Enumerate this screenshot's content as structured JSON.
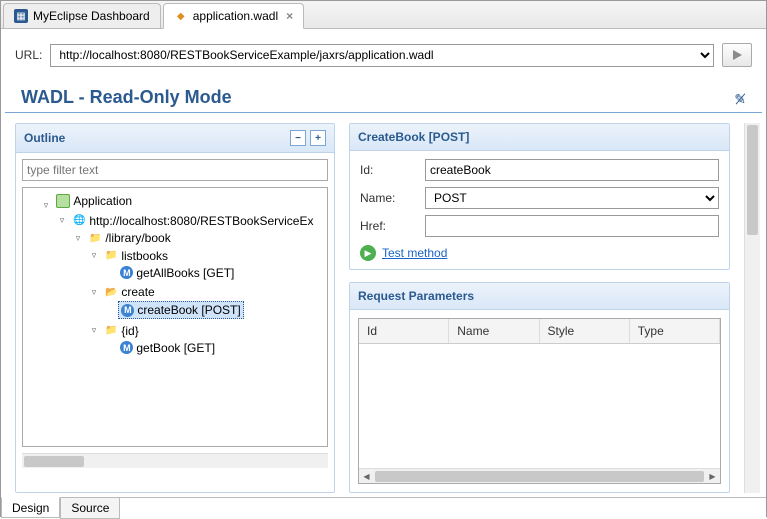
{
  "tabs": {
    "dashboard": "MyEclipse Dashboard",
    "active": "application.wadl"
  },
  "urlbar": {
    "label": "URL:",
    "value": "http://localhost:8080/RESTBookServiceExample/jaxrs/application.wadl"
  },
  "header": {
    "title": "WADL - Read-Only Mode"
  },
  "outline": {
    "title": "Outline",
    "filter_placeholder": "type filter text",
    "tree": {
      "app": "Application",
      "host": "http://localhost:8080/RESTBookServiceEx",
      "path": "/library/book",
      "listbooks": "listbooks",
      "getall": "getAllBooks [GET]",
      "create": "create",
      "createbook": "createBook [POST]",
      "id": "{id}",
      "getbook": "getBook [GET]"
    }
  },
  "detail": {
    "heading": "CreateBook [POST]",
    "id_label": "Id:",
    "id_value": "createBook",
    "name_label": "Name:",
    "name_value": "POST",
    "href_label": "Href:",
    "href_value": "",
    "test_link": "Test method"
  },
  "params": {
    "heading": "Request Parameters",
    "cols": {
      "id": "Id",
      "name": "Name",
      "style": "Style",
      "type": "Type"
    }
  },
  "bottom": {
    "design": "Design",
    "source": "Source"
  }
}
